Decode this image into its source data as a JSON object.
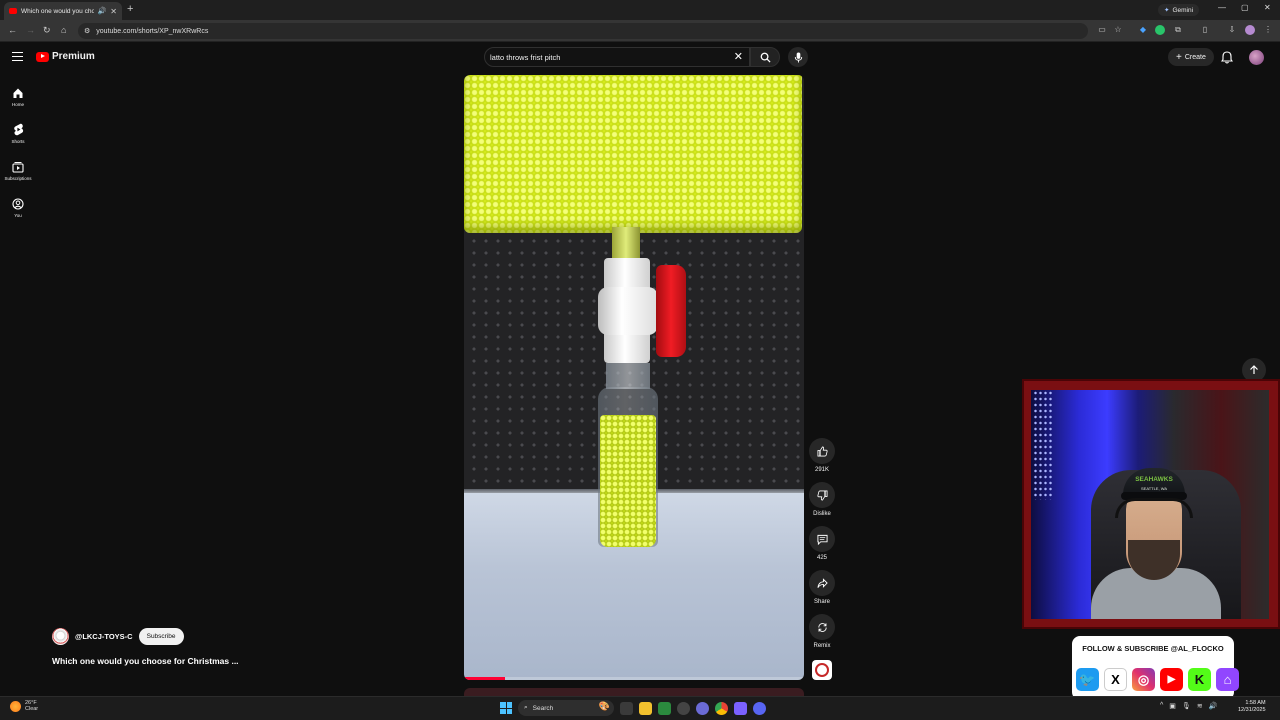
{
  "browser": {
    "tab_title": "Which one would you choo",
    "url": "youtube.com/shorts/XP_nwXRwRcs",
    "gemini_label": "Gemini"
  },
  "youtube": {
    "logo_label": "Premium",
    "search_value": "latto throws frist pitch",
    "create_label": "Create",
    "nav": [
      {
        "label": "Home",
        "icon": "home-icon"
      },
      {
        "label": "Shorts",
        "icon": "shorts-icon"
      },
      {
        "label": "Subscriptions",
        "icon": "subscriptions-icon"
      },
      {
        "label": "You",
        "icon": "you-icon"
      }
    ]
  },
  "short": {
    "channel": "@LKCJ-TOYS-C",
    "subscribe_label": "Subscribe",
    "title": "Which one would you choose for Christmas ...",
    "progress_fraction": 0.12,
    "actions": {
      "like_count": "291K",
      "dislike_label": "Dislike",
      "comment_count": "425",
      "share_label": "Share",
      "remix_label": "Remix"
    }
  },
  "overlay": {
    "cap_text": "SEAHAWKS",
    "cap_subtext": "SEATTLE, WA",
    "follow_text": "FOLLOW & SUBSCRIBE @AL_FLOCKO",
    "socials": [
      "twitter-icon",
      "x-icon",
      "instagram-icon",
      "youtube-icon",
      "kick-icon",
      "twitch-icon"
    ]
  },
  "taskbar": {
    "temp": "26°F",
    "condition": "Clear",
    "search_label": "Search",
    "time": "1:58 AM",
    "date": "12/31/2025"
  },
  "colors": {
    "accent": "#ff0000",
    "background": "#0f0f0f"
  }
}
